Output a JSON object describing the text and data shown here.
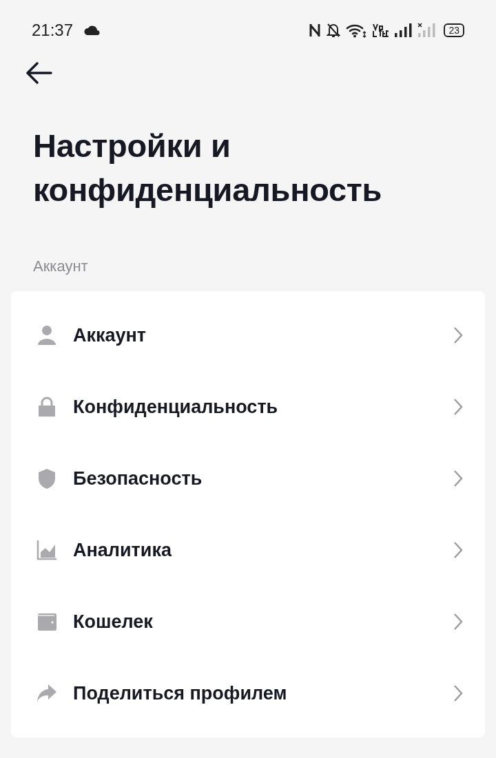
{
  "status_bar": {
    "time": "21:37",
    "battery": "23"
  },
  "title": "Настройки и конфиденциальность",
  "section": {
    "label": "Аккаунт",
    "items": [
      {
        "kind": "person",
        "label": "Аккаунт"
      },
      {
        "kind": "lock",
        "label": "Конфиденциальность"
      },
      {
        "kind": "shield",
        "label": "Безопасность"
      },
      {
        "kind": "chart",
        "label": "Аналитика"
      },
      {
        "kind": "wallet",
        "label": "Кошелек"
      },
      {
        "kind": "share",
        "label": "Поделиться профилем"
      }
    ]
  }
}
